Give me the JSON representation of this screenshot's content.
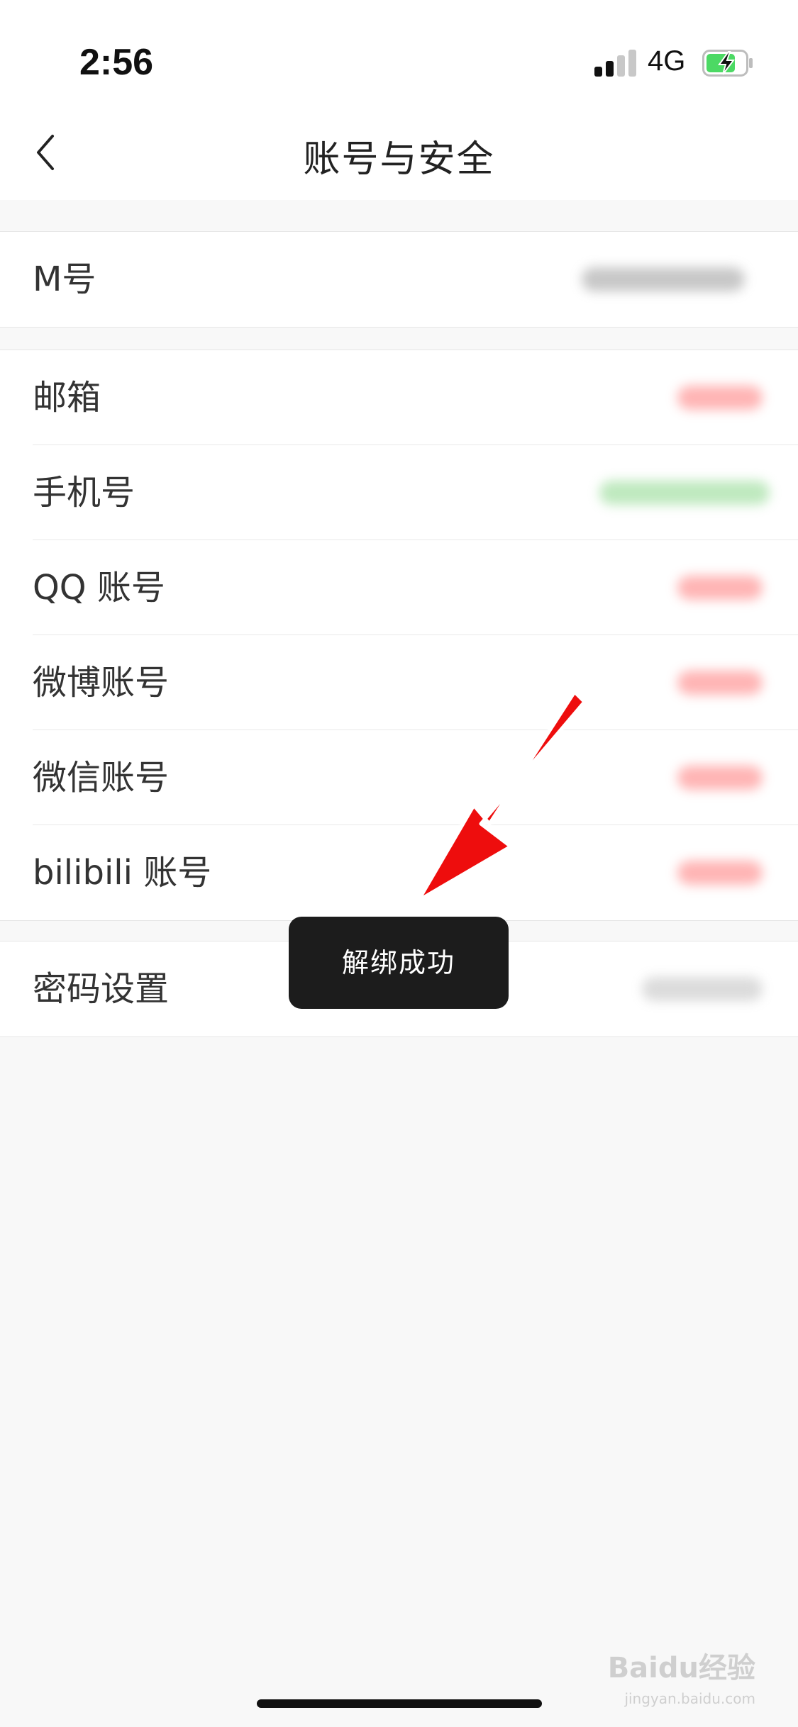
{
  "status_bar": {
    "time": "2:56",
    "network": "4G",
    "signal_icon": "signal-bars-icon",
    "battery_icon": "battery-charging-icon",
    "battery_color": "#4cd964"
  },
  "nav": {
    "title": "账号与安全",
    "back_icon": "chevron-left-icon"
  },
  "groups": [
    {
      "items": [
        {
          "label": "M号"
        }
      ]
    },
    {
      "items": [
        {
          "label": "邮箱"
        },
        {
          "label": "手机号"
        },
        {
          "label": "QQ 账号"
        },
        {
          "label": "微博账号"
        },
        {
          "label": "微信账号"
        },
        {
          "label": "bilibili 账号"
        }
      ]
    },
    {
      "items": [
        {
          "label": "密码设置"
        }
      ]
    }
  ],
  "toast": {
    "message": "解绑成功"
  },
  "annotation": {
    "arrow_color": "#ee1111"
  },
  "watermark": {
    "text": "Baidu经验",
    "sub": "jingyan.baidu.com"
  }
}
